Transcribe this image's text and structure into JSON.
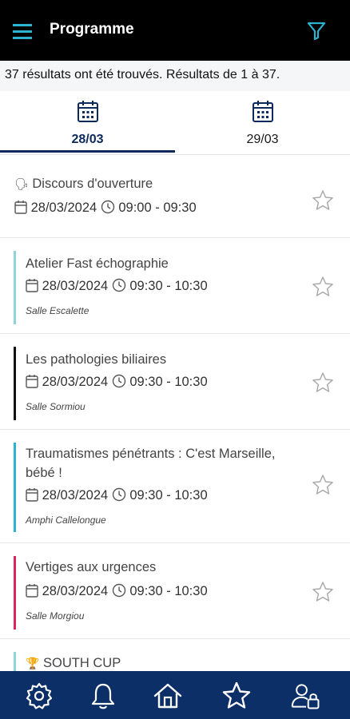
{
  "header": {
    "title": "Programme",
    "menu_icon": "hamburger-menu-icon",
    "filter_icon": "filter-icon"
  },
  "results_text": "37 résultats ont été trouvés. Résultats de 1 à 37.",
  "tabs": [
    {
      "label": "28/03",
      "selected": true,
      "icon": "calendar-icon"
    },
    {
      "label": "29/03",
      "selected": false,
      "icon": "calendar-icon"
    }
  ],
  "sessions": [
    {
      "prefix": "🗣",
      "title": "Discours d'ouverture",
      "date": "28/03/2024",
      "time": "09:00 - 09:30",
      "room": "",
      "color": ""
    },
    {
      "prefix": "",
      "title": "Atelier Fast échographie",
      "date": "28/03/2024",
      "time": "09:30 - 10:30",
      "room": "Salle Escalette",
      "color": "#8fd3dc"
    },
    {
      "prefix": "",
      "title": "Les pathologies biliaires",
      "date": "28/03/2024",
      "time": "09:30 - 10:30",
      "room": "Salle Sormiou",
      "color": "#111111"
    },
    {
      "prefix": "",
      "title": "Traumatismes pénétrants : C'est Marseille, bébé !",
      "date": "28/03/2024",
      "time": "09:30 - 10:30",
      "room": "Amphi Callelongue",
      "color": "#2bb3d0"
    },
    {
      "prefix": "",
      "title": "Vertiges aux urgences",
      "date": "28/03/2024",
      "time": "09:30 - 10:30",
      "room": "Salle Morgiou",
      "color": "#e0245e"
    },
    {
      "prefix": "🏆",
      "title": "SOUTH CUP",
      "date": "",
      "time": "",
      "room": "",
      "color": "#8fd3dc"
    }
  ],
  "bottom_nav": [
    {
      "name": "settings",
      "icon": "gear-icon"
    },
    {
      "name": "notifications",
      "icon": "bell-icon"
    },
    {
      "name": "home",
      "icon": "home-icon"
    },
    {
      "name": "favorites",
      "icon": "star-icon"
    },
    {
      "name": "account",
      "icon": "user-lock-icon"
    }
  ],
  "colors": {
    "header_bg": "#000000",
    "accent": "#2bb3d0",
    "nav_bg": "#0b2f66",
    "selected_tab": "#0b2a5b"
  }
}
